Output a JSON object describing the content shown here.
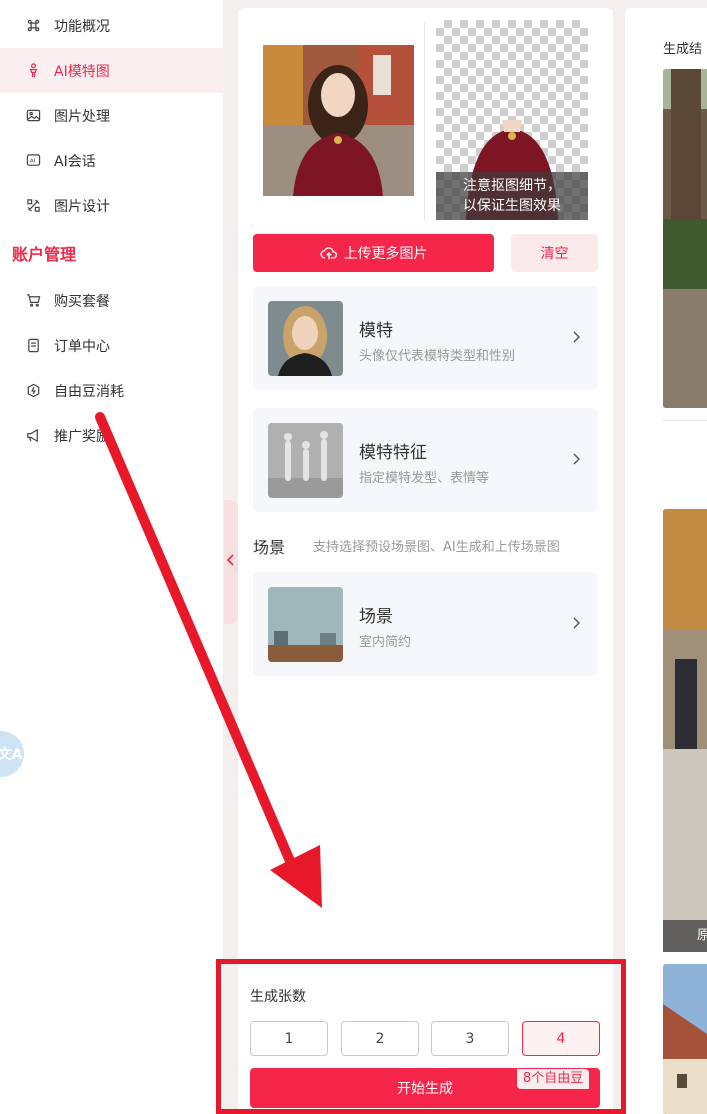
{
  "sidebar": {
    "items": [
      {
        "label": "功能概况",
        "icon": "command-icon"
      },
      {
        "label": "AI模特图",
        "icon": "model-figure-icon",
        "active": true
      },
      {
        "label": "图片处理",
        "icon": "image-icon"
      },
      {
        "label": "AI会话",
        "icon": "ai-chat-icon"
      },
      {
        "label": "图片设计",
        "icon": "design-tools-icon"
      }
    ],
    "section_title": "账户管理",
    "account_items": [
      {
        "label": "购买套餐",
        "icon": "cart-icon"
      },
      {
        "label": "订单中心",
        "icon": "order-icon"
      },
      {
        "label": "自由豆消耗",
        "icon": "bean-icon"
      },
      {
        "label": "推广奖励",
        "icon": "megaphone-icon"
      }
    ],
    "translate_fab": "文A"
  },
  "upload": {
    "cutout_notice_line1": "注意抠图细节，",
    "cutout_notice_line2": "以保证生图效果",
    "upload_more_label": "上传更多图片",
    "clear_label": "清空"
  },
  "options": {
    "model": {
      "title": "模特",
      "subtitle": "头像仅代表模特类型和性别"
    },
    "model_features": {
      "title": "模特特征",
      "subtitle": "指定模特发型、表情等"
    },
    "scene_label": "场景",
    "scene_hint": "支持选择预设场景图、AI生成和上传场景图",
    "scene": {
      "title": "场景",
      "subtitle": "室内简约"
    }
  },
  "generate": {
    "count_label": "生成张数",
    "counts": [
      "1",
      "2",
      "3",
      "4"
    ],
    "selected_count": "4",
    "start_label": "开始生成",
    "cost_badge": "8个自由豆"
  },
  "results": {
    "title": "生成结",
    "orig_tag": "原"
  },
  "colors": {
    "accent": "#f5264a",
    "annotation": "#e8182b",
    "active_bg": "#fbeff1"
  }
}
